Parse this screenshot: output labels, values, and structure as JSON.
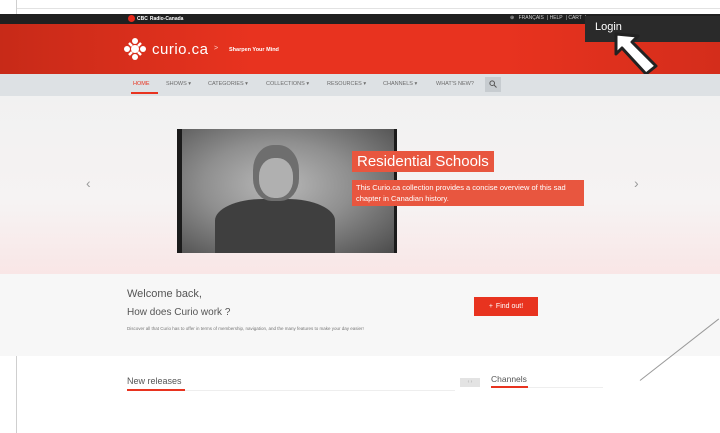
{
  "topbar": {
    "network": "CBC",
    "network_full": "Radio-Canada",
    "links": [
      "FRANÇAIS",
      "HELP",
      "CART"
    ]
  },
  "login": {
    "label": "Login"
  },
  "header": {
    "logo": "curio.ca",
    "tagline": "Sharpen Your Mind",
    "separator": ">"
  },
  "nav": {
    "items": [
      {
        "label": "HOME"
      },
      {
        "label": "SHOWS ▾"
      },
      {
        "label": "CATEGORIES ▾"
      },
      {
        "label": "COLLECTIONS ▾"
      },
      {
        "label": "RESOURCES ▾"
      },
      {
        "label": "CHANNELS ▾"
      },
      {
        "label": "WHAT'S NEW?"
      }
    ]
  },
  "hero": {
    "title": "Residential Schools",
    "description": "This Curio.ca collection provides a concise overview of this sad chapter in Canadian history.",
    "prev": "‹",
    "next": "›"
  },
  "welcome": {
    "greeting": "Welcome back,",
    "question": "How does Curio work ?",
    "body": "Discover all that Curio has to offer in terms of membership, navigation, and the many features to make your day easier!",
    "button": "Find out!",
    "button_icon": "+"
  },
  "sections": {
    "new_releases": "New releases",
    "pager": "‹ ›",
    "channels": "Channels"
  },
  "colors": {
    "brand_red": "#e8331f",
    "topbar": "#202020",
    "nav_bg": "#dde1e4"
  }
}
